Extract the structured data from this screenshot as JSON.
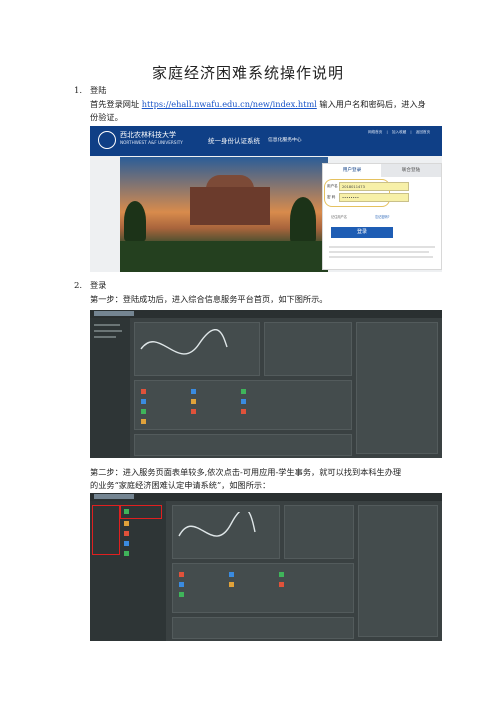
{
  "doc": {
    "title": "家庭经济困难系统操作说明",
    "section1": {
      "number": "1.",
      "heading": "登陆",
      "text_before_link": "首先登录网址 ",
      "link": "https://ehall.nwafu.edu.cn/new/index.html",
      "text_after_link": " 输入用户名和密码后，进入身",
      "text_line2": "份验证。"
    },
    "section2": {
      "number": "2.",
      "heading": "登录",
      "step1": "第一步：登陆成功后，进入综合信息服务平台首页，如下图所示。",
      "step2_line1": "第二步：进入服务页面表单较多,依次点击-可用应用-学生事务，就可以找到本科生办理",
      "step2_line2": "的业务“家庭经济困难认定申请系统”，如图所示："
    }
  },
  "login_screenshot": {
    "univ_name": "西北农林科技大学",
    "univ_en": "NORTHWEST A&F UNIVERSITY",
    "system_name": "统一身份认证系统",
    "system_sub": "信息化服务中心",
    "top_links": "网络首页 | 加入收藏 | 返回首页",
    "tab_user": "用户登录",
    "tab_other": "联合登陆",
    "username_label": "用户名",
    "username_value": "2018011473",
    "password_label": "密  码",
    "password_value": "••••••••",
    "remember": "记住用户名",
    "forgot": "忘记密码?",
    "login_button": "登录"
  },
  "colors": {
    "header_blue": "#0f3f86",
    "link_blue": "#1a55c8",
    "highlight_yellow": "#e5c15f",
    "portal_dark": "#3a4142",
    "annotation_red": "#e02020"
  }
}
